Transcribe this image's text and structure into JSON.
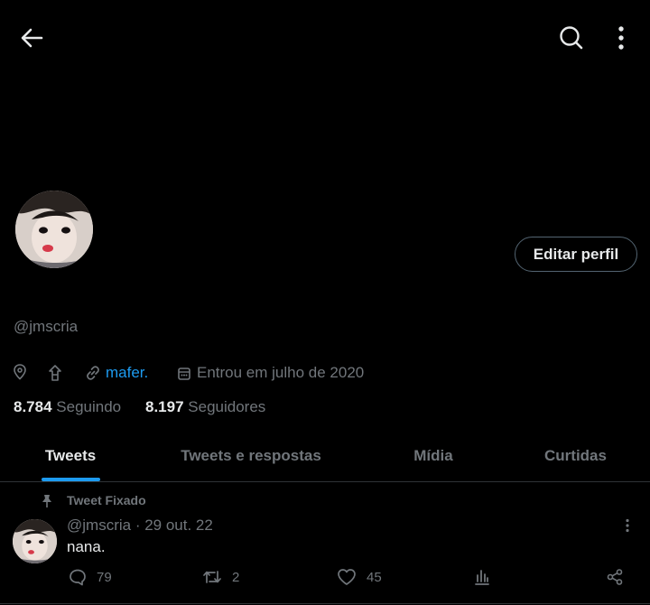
{
  "header": {
    "back_icon": "arrow-left-icon",
    "search_icon": "search-icon",
    "more_icon": "more-vertical-icon"
  },
  "profile": {
    "handle": "@jmscria",
    "edit_button": "Editar perfil",
    "location_icon": "location-pin-icon",
    "birthday_icon": "balloon-icon",
    "website_icon": "link-icon",
    "website": "mafer.",
    "joined_icon": "calendar-icon",
    "joined": "Entrou em julho de 2020",
    "following_count": "8.784",
    "following_label": "Seguindo",
    "followers_count": "8.197",
    "followers_label": "Seguidores"
  },
  "tabs": [
    {
      "label": "Tweets",
      "active": true
    },
    {
      "label": "Tweets e respostas",
      "active": false
    },
    {
      "label": "Mídia",
      "active": false
    },
    {
      "label": "Curtidas",
      "active": false
    }
  ],
  "pinned_tweet": {
    "pinned_label": "Tweet Fixado",
    "handle": "@jmscria",
    "date": "· 29 out. 22",
    "text": "nana.",
    "replies": "79",
    "retweets": "2",
    "likes": "45"
  },
  "colors": {
    "background": "#000000",
    "text": "#e7e9ea",
    "muted": "#71767b",
    "accent": "#1d9bf0",
    "border": "#2f3336"
  }
}
